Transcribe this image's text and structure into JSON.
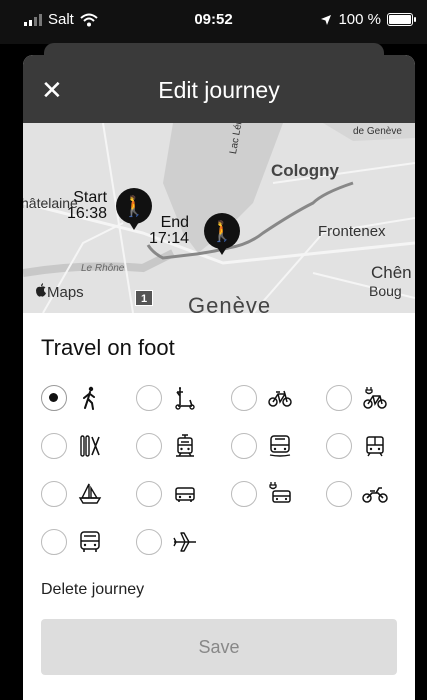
{
  "status_bar": {
    "carrier": "Salt",
    "time": "09:52",
    "battery": "100 %"
  },
  "header": {
    "close_icon": "close-icon",
    "title": "Edit journey"
  },
  "map": {
    "labels": {
      "de_geneve": "de Genève",
      "lac_leman": "Lac Léman",
      "cologny": "Cologny",
      "chatelaine": "hâtelaine",
      "frontenex": "Frontenex",
      "le_rhone": "Le Rhône",
      "geneve": "Genève",
      "chen": "Chên",
      "boug": "Boug",
      "maps": "Maps",
      "road_badge": "1"
    },
    "start": {
      "label": "Start",
      "time": "16:38"
    },
    "end": {
      "label": "End",
      "time": "17:14"
    }
  },
  "travel_mode_title": "Travel on foot",
  "modes": [
    {
      "icon": "walk-icon",
      "selected": true
    },
    {
      "icon": "scooter-icon",
      "selected": false
    },
    {
      "icon": "bicycle-icon",
      "selected": false
    },
    {
      "icon": "ebike-icon",
      "selected": false
    },
    {
      "icon": "ski-icon",
      "selected": false
    },
    {
      "icon": "train-icon",
      "selected": false
    },
    {
      "icon": "bus-icon",
      "selected": false
    },
    {
      "icon": "tram-icon",
      "selected": false
    },
    {
      "icon": "boat-icon",
      "selected": false
    },
    {
      "icon": "car-icon",
      "selected": false
    },
    {
      "icon": "electric-car-icon",
      "selected": false
    },
    {
      "icon": "motorbike-icon",
      "selected": false
    },
    {
      "icon": "coach-icon",
      "selected": false
    },
    {
      "icon": "plane-icon",
      "selected": false
    }
  ],
  "delete_label": "Delete journey",
  "save_label": "Save"
}
